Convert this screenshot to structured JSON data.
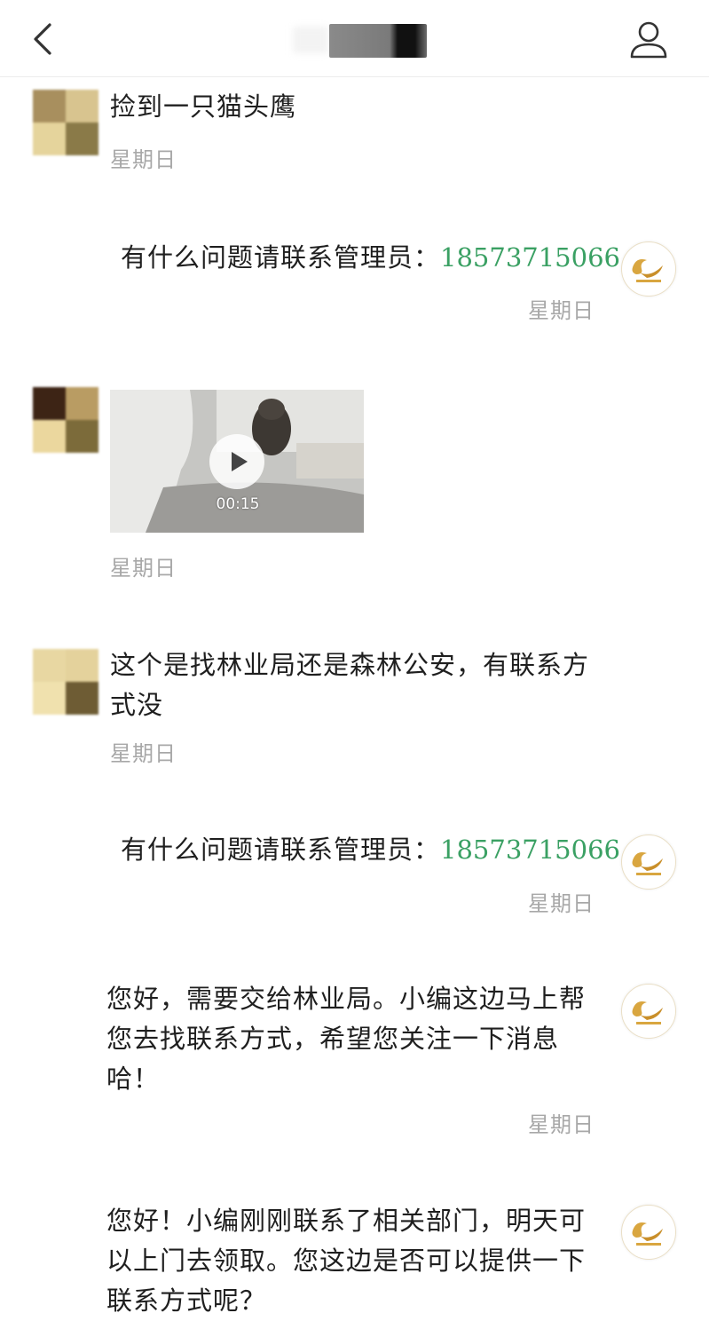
{
  "header": {
    "back_icon": "chevron-left-icon",
    "profile_icon": "person-icon"
  },
  "messages": [
    {
      "sender": "user",
      "text": "捡到一只猫头鹰",
      "time": "星期日"
    },
    {
      "sender": "org",
      "text": "有什么问题请联系管理员：",
      "phone": "18573715066",
      "time": "星期日"
    },
    {
      "sender": "user",
      "type": "video",
      "duration": "00:15",
      "time": "星期日"
    },
    {
      "sender": "user",
      "lines": [
        "这个是找林业局还是森林公安，有联系方",
        "式没"
      ],
      "time": "星期日"
    },
    {
      "sender": "org",
      "text": "有什么问题请联系管理员：",
      "phone": "18573715066",
      "time": "星期日"
    },
    {
      "sender": "org",
      "lines": [
        "您好，需要交给林业局。小编这边马上帮",
        "您去找联系方式，希望您关注一下消息",
        "哈！"
      ],
      "time": "星期日"
    },
    {
      "sender": "org",
      "lines": [
        "您好！小编刚刚联系了相关部门，明天可",
        "以上门去领取。您这边是否可以提供一下",
        "联系方式呢？"
      ]
    }
  ],
  "colors": {
    "phone_link": "#3aa063",
    "timestamp": "#a8a8a8",
    "org_logo": "#d9a640"
  }
}
